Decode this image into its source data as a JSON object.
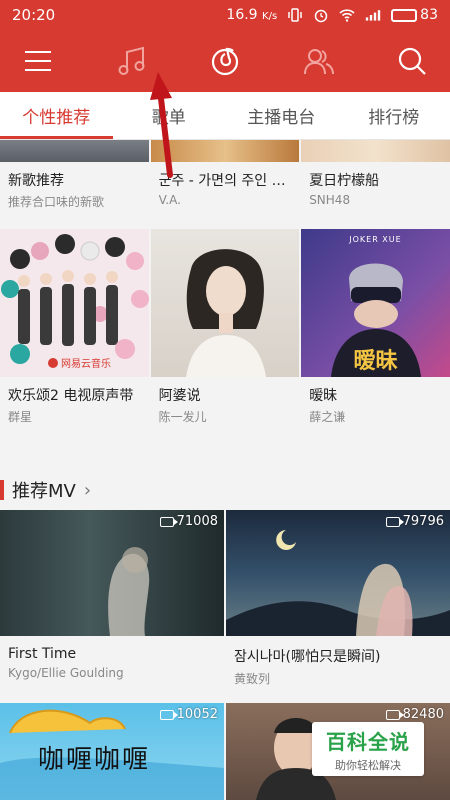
{
  "status": {
    "time": "20:20",
    "speed": "16.9",
    "speed_unit": "K/s",
    "battery": "83",
    "battery_level": 0.83
  },
  "appbar": {
    "icons": [
      "menu-icon",
      "music-note-icon",
      "netease-logo-icon",
      "friends-icon",
      "search-icon"
    ]
  },
  "tabs": [
    {
      "label": "个性推荐",
      "active": true
    },
    {
      "label": "歌单",
      "active": false
    },
    {
      "label": "主播电台",
      "active": false
    },
    {
      "label": "排行榜",
      "active": false
    }
  ],
  "playlists_row1": [
    {
      "title": "新歌推荐",
      "subtitle": "推荐合口味的新歌"
    },
    {
      "title": "군주 - 가면의 주인 OS..",
      "subtitle": "V.A."
    },
    {
      "title": "夏日柠檬船",
      "subtitle": "SNH48"
    }
  ],
  "playlists_row2": [
    {
      "title": "欢乐颂2 电视原声带",
      "subtitle": "群星",
      "badge": "网易云音乐"
    },
    {
      "title": "阿婆说",
      "subtitle": "陈一发儿"
    },
    {
      "title": "暧昧",
      "subtitle": "薛之谦",
      "cover_text_top": "JOKER XUE",
      "cover_text": "暧昧"
    }
  ],
  "mv_section": {
    "title": "推荐MV",
    "chevron": "›"
  },
  "mvs_row1": [
    {
      "title": "First Time",
      "subtitle": "Kygo/Ellie Goulding",
      "count": "71008"
    },
    {
      "title": "잠시나마(哪怕只是瞬间)",
      "subtitle": "黄致列",
      "count": "79796"
    }
  ],
  "mvs_row2": [
    {
      "count": "10052",
      "cover_text": "咖喱咖喱"
    },
    {
      "count": "82480"
    }
  ],
  "watermark": {
    "line1": "百科全说",
    "line2": "助你轻松解决"
  },
  "colors": {
    "brand_red": "#d63a31",
    "watermark_green": "#2aa24a"
  }
}
